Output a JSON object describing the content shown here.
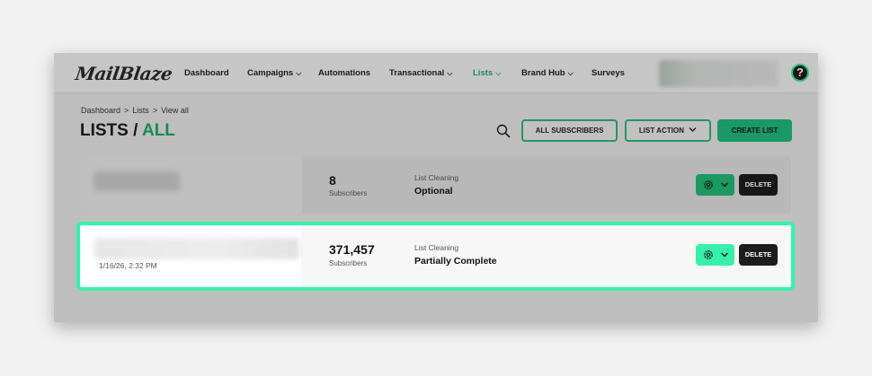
{
  "brand": {
    "logo_text": "MailBlaze",
    "accent": "#2ef5a8",
    "primary_green": "#1fb77a"
  },
  "nav": {
    "items": [
      {
        "label": "Dashboard",
        "caret": false
      },
      {
        "label": "Campaigns",
        "caret": true
      },
      {
        "label": "Automations",
        "caret": false
      },
      {
        "label": "Transactional",
        "caret": true
      },
      {
        "label": "Lists",
        "caret": true,
        "active": true
      },
      {
        "label": "Brand Hub",
        "caret": true
      },
      {
        "label": "Surveys",
        "caret": false
      }
    ],
    "help_label": "?"
  },
  "breadcrumb": {
    "items": [
      "Dashboard",
      ">",
      "Lists",
      ">",
      "View all"
    ]
  },
  "title": {
    "main": "LISTS",
    "separator": "/",
    "accent": "ALL"
  },
  "toolbar": {
    "all_subscribers_label": "ALL SUBSCRIBERS",
    "list_action_label": "LIST ACTION",
    "create_list_label": "CREATE LIST"
  },
  "lists": [
    {
      "subscribers": "8",
      "subscribers_label": "Subscribers",
      "cleaning_label": "List Cleaning",
      "cleaning_value": "Optional",
      "delete_label": "DELETE"
    },
    {
      "date": "1/16/26, 2:32 PM",
      "subscribers": "371,457",
      "subscribers_label": "Subscribers",
      "cleaning_label": "List Cleaning",
      "cleaning_value": "Partially Complete",
      "delete_label": "DELETE",
      "highlighted": true
    }
  ]
}
